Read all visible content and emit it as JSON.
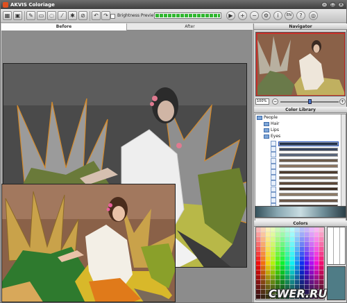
{
  "window": {
    "title": "AKVIS Coloriage"
  },
  "toolbar": {
    "brightness_preview_label": "Brightness Preview",
    "progress_value": 1.0,
    "language": "EN"
  },
  "view_tabs": [
    {
      "label": "Before",
      "active": true
    },
    {
      "label": "After",
      "active": false
    }
  ],
  "navigator": {
    "title": "Navigator",
    "zoom": "100%"
  },
  "color_library": {
    "title": "Color Library",
    "tree": [
      {
        "label": "People",
        "level": 0
      },
      {
        "label": "Hair",
        "level": 1
      },
      {
        "label": "Lips",
        "level": 1
      },
      {
        "label": "Eyes",
        "level": 1
      }
    ],
    "swatches": [
      "#1f2f4a",
      "#3a4660",
      "#59657a",
      "#6b5a4a",
      "#8a7460",
      "#4b3a2c",
      "#7a6a5a",
      "#5a4636",
      "#3d2e24",
      "#8c7a66",
      "#6a5646",
      "#2e241c",
      "#9a8874",
      "#5e4a3a"
    ]
  },
  "colors": {
    "title": "Colors",
    "current": "#4f7c86"
  },
  "watermark": "CWER.RU"
}
